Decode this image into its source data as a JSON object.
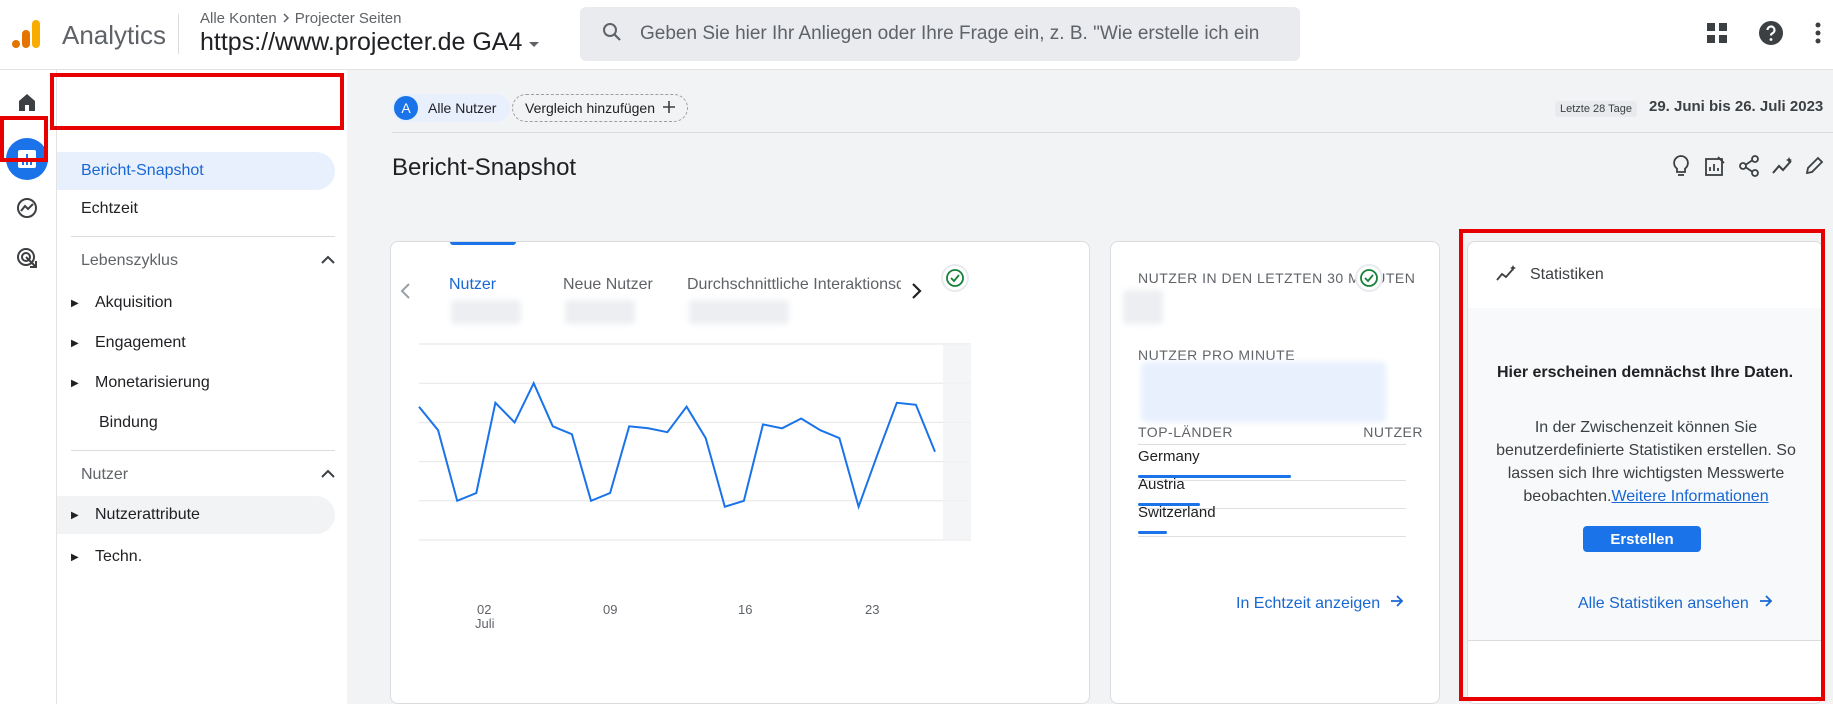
{
  "app": {
    "name": "Analytics",
    "breadcrumb": [
      "Alle Konten",
      "Projecter Seiten"
    ],
    "property": "https://www.projecter.de GA4"
  },
  "search": {
    "placeholder": "Geben Sie hier Ihr Anliegen oder Ihre Frage ein, z. B. \"Wie erstelle ich eine..."
  },
  "nav": {
    "top_items": [
      "Bericht-Snapshot",
      "Echtzeit"
    ],
    "lifecycle": {
      "title": "Lebenszyklus",
      "items": [
        "Akquisition",
        "Engagement",
        "Monetarisierung",
        "Bindung"
      ]
    },
    "users": {
      "title": "Nutzer",
      "items": [
        "Nutzerattribute",
        "Techn."
      ]
    }
  },
  "filters": {
    "user_chip_letter": "A",
    "user_chip": "Alle Nutzer",
    "compare": "Vergleich hinzufügen"
  },
  "date": {
    "label": "Letzte 28 Tage",
    "range": "29. Juni bis 26. Juli 2023"
  },
  "page_title": "Bericht-Snapshot",
  "main_card": {
    "tabs": [
      "Nutzer",
      "Neue Nutzer",
      "Durchschnittliche Interaktionsdau"
    ],
    "x_ticks": [
      "02",
      "09",
      "16",
      "23"
    ],
    "x_month": "Juli"
  },
  "chart_data": {
    "type": "line",
    "title": "",
    "xlabel": "",
    "ylabel": "",
    "x": [
      "29.06",
      "30.06",
      "01.07",
      "02.07",
      "03.07",
      "04.07",
      "05.07",
      "06.07",
      "07.07",
      "08.07",
      "09.07",
      "10.07",
      "11.07",
      "12.07",
      "13.07",
      "14.07",
      "15.07",
      "16.07",
      "17.07",
      "18.07",
      "19.07",
      "20.07",
      "21.07",
      "22.07",
      "23.07",
      "24.07",
      "25.07",
      "26.07"
    ],
    "series": [
      {
        "values": [
          0.68,
          0.56,
          0.2,
          0.24,
          0.7,
          0.6,
          0.8,
          0.58,
          0.54,
          0.2,
          0.24,
          0.58,
          0.57,
          0.55,
          0.68,
          0.52,
          0.17,
          0.2,
          0.59,
          0.57,
          0.62,
          0.56,
          0.52,
          0.17,
          0.44,
          0.7,
          0.69,
          0.45
        ]
      }
    ],
    "ylim": [
      0,
      1
    ],
    "grid": true,
    "color": "#1a73e8"
  },
  "realtime": {
    "title": "NUTZER IN DEN LETZTEN 30 MINUTEN",
    "per_minute": "NUTZER PRO MINUTE",
    "col_country": "TOP-LÄNDER",
    "col_users": "NUTZER",
    "countries": [
      {
        "name": "Germany",
        "share": 0.57
      },
      {
        "name": "Austria",
        "share": 0.23
      },
      {
        "name": "Switzerland",
        "share": 0.11
      }
    ],
    "link": "In Echtzeit anzeigen"
  },
  "stats": {
    "title": "Statistiken",
    "heading": "Hier erscheinen demnächst Ihre Daten.",
    "text": "In der Zwischenzeit können Sie benutzerdefinierte Statistiken erstellen. So lassen sich Ihre wichtigsten Messwerte beobachten.",
    "more_link": "Weitere Informationen",
    "button": "Erstellen",
    "link": "Alle Statistiken ansehen"
  },
  "colors": {
    "accent": "#1a73e8",
    "highlight_box": "#e60000",
    "logo_orange": "#f9ab00",
    "logo_dark": "#e37400"
  }
}
